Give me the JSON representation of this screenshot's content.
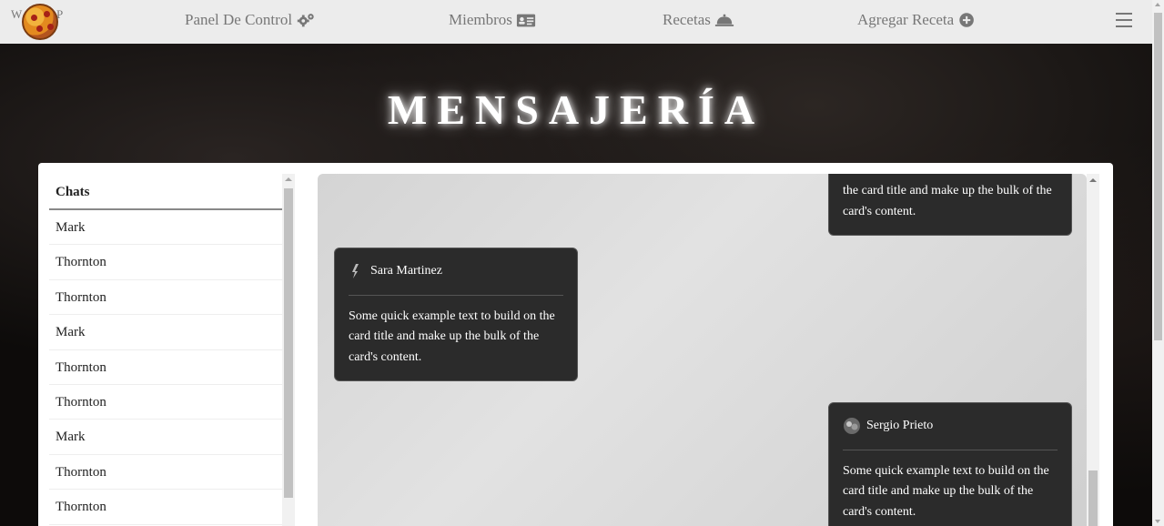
{
  "nav": {
    "brand_left": "W",
    "brand_right": "P",
    "items": [
      {
        "label": "Panel De Control",
        "icon": "gears-icon"
      },
      {
        "label": "Miembros",
        "icon": "id-card-icon"
      },
      {
        "label": "Recetas",
        "icon": "cloche-icon"
      },
      {
        "label": "Agregar Receta",
        "icon": "plus-circle-icon"
      }
    ],
    "menu_icon": "hamburger-icon"
  },
  "page_title": "MENSAJERÍA",
  "chats": {
    "header": "Chats",
    "items": [
      "Mark",
      "Thornton",
      "Thornton",
      "Mark",
      "Thornton",
      "Thornton",
      "Mark",
      "Thornton",
      "Thornton"
    ]
  },
  "messages": [
    {
      "author": "",
      "text": "the card title and make up the bulk of the card's content.",
      "side": "right"
    },
    {
      "author": "Sara Martinez",
      "text": "Some quick example text to build on the card title and make up the bulk of the card's content.",
      "side": "left"
    },
    {
      "author": "Sergio Prieto",
      "text": "Some quick example text to build on the card title and make up the bulk of the card's content.",
      "side": "right"
    }
  ],
  "colors": {
    "navbar": "#ececec",
    "card": "#2b2b2b",
    "nav_text": "#777777"
  }
}
